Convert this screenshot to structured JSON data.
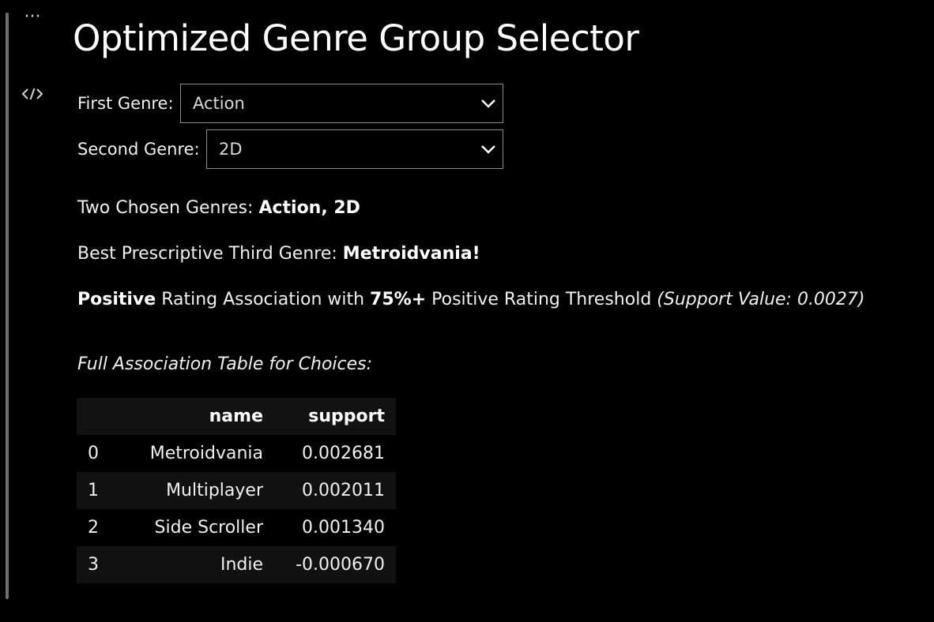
{
  "cell": {
    "more_icon": "ellipsis-icon",
    "code_icon": "code-toggle-icon"
  },
  "title": "Optimized Genre Group Selector",
  "selectors": {
    "first": {
      "label": "First Genre:",
      "value": "Action"
    },
    "second": {
      "label": "Second Genre:",
      "value": "2D"
    }
  },
  "result": {
    "chosen_prefix": "Two Chosen Genres: ",
    "chosen_value": "Action, 2D",
    "third_prefix": "Best Prescriptive Third Genre: ",
    "third_value": "Metroidvania!",
    "assoc_strong": "Positive",
    "assoc_mid": " Rating Association with ",
    "assoc_threshold": "75%+",
    "assoc_rest": " Positive Rating Threshold ",
    "assoc_support": "(Support Value: 0.0027)"
  },
  "table": {
    "caption": "Full Association Table for Choices:",
    "headers": [
      "",
      "name",
      "support"
    ],
    "rows": [
      {
        "index": "0",
        "name": "Metroidvania",
        "support": "0.002681"
      },
      {
        "index": "1",
        "name": "Multiplayer",
        "support": "0.002011"
      },
      {
        "index": "2",
        "name": "Side Scroller",
        "support": "0.001340"
      },
      {
        "index": "3",
        "name": "Indie",
        "support": "-0.000670"
      }
    ]
  }
}
